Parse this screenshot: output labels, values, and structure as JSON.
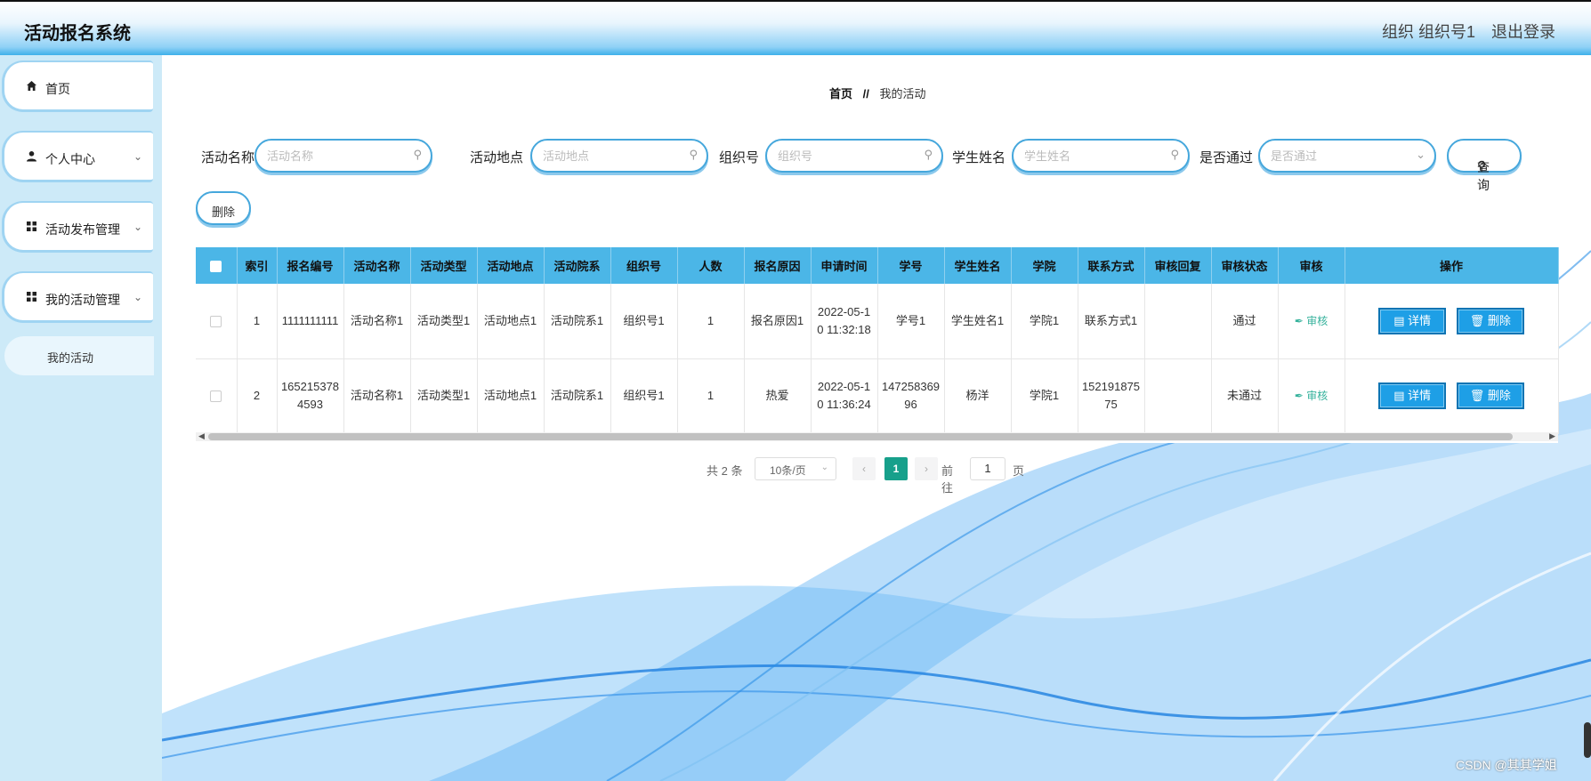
{
  "app": {
    "title": "活动报名系统",
    "user": "组织 组织号1",
    "logout": "退出登录"
  },
  "sidebar": {
    "items": [
      {
        "label": "首页",
        "icon": "home-icon"
      },
      {
        "label": "个人中心",
        "icon": "user-icon"
      },
      {
        "label": "活动发布管理",
        "icon": "grid-icon"
      },
      {
        "label": "我的活动管理",
        "icon": "grid-icon"
      }
    ],
    "submenu": {
      "label": "我的活动"
    }
  },
  "breadcrumb": {
    "home": "首页",
    "sep": "//",
    "current": "我的活动"
  },
  "search": {
    "activity_name_label": "活动名称",
    "activity_name_placeholder": "活动名称",
    "location_label": "活动地点",
    "location_placeholder": "活动地点",
    "org_label": "组织号",
    "org_placeholder": "组织号",
    "student_label": "学生姓名",
    "student_placeholder": "学生姓名",
    "passed_label": "是否通过",
    "passed_placeholder": "是否通过",
    "query_button": "查询"
  },
  "toolbar": {
    "delete_label": "删除"
  },
  "table": {
    "headers": [
      "索引",
      "报名编号",
      "活动名称",
      "活动类型",
      "活动地点",
      "活动院系",
      "组织号",
      "人数",
      "报名原因",
      "申请时间",
      "学号",
      "学生姓名",
      "学院",
      "联系方式",
      "审核回复",
      "审核状态",
      "审核",
      "操作"
    ],
    "rows": [
      [
        "1",
        "1111111111",
        "活动名称1",
        "活动类型1",
        "活动地点1",
        "活动院系1",
        "组织号1",
        "1",
        "报名原因1",
        "2022-05-10 11:32:18",
        "学号1",
        "学生姓名1",
        "学院1",
        "联系方式1",
        "",
        "通过",
        "审核",
        ""
      ],
      [
        "2",
        "1652153784593",
        "活动名称1",
        "活动类型1",
        "活动地点1",
        "活动院系1",
        "组织号1",
        "1",
        "热爱",
        "2022-05-10 11:36:24",
        "14725836996",
        "杨洋",
        "学院1",
        "15219187575",
        "",
        "未通过",
        "审核",
        ""
      ]
    ],
    "detail_button": "详情",
    "delete_button": "删除"
  },
  "pagination": {
    "total": "共 2 条",
    "page_size": "10条/页",
    "current_page": "1",
    "goto_label": "前往",
    "goto_value": "1",
    "page_unit": "页"
  },
  "watermark": "CSDN @其其学姐",
  "colors": {
    "header_blue": "#4bb6e7",
    "accent": "#1e9fe6",
    "pager_active": "#17a08b",
    "audit_green": "#36b29c"
  }
}
